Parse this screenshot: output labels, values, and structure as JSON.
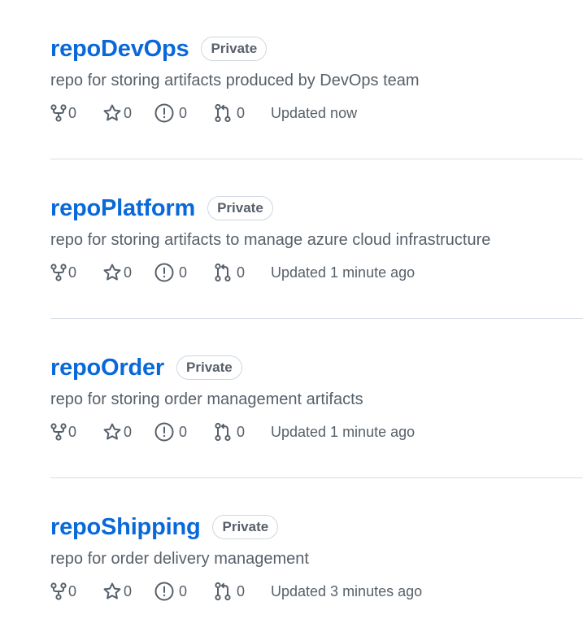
{
  "repos": [
    {
      "name": "repoDevOps",
      "visibility": "Private",
      "description": "repo for storing artifacts produced by DevOps team",
      "forks": "0",
      "stars": "0",
      "issues": "0",
      "pulls": "0",
      "updated": "Updated now"
    },
    {
      "name": "repoPlatform",
      "visibility": "Private",
      "description": "repo for storing artifacts to manage azure cloud infrastructure",
      "forks": "0",
      "stars": "0",
      "issues": "0",
      "pulls": "0",
      "updated": "Updated 1 minute ago"
    },
    {
      "name": "repoOrder",
      "visibility": "Private",
      "description": "repo for storing order management artifacts",
      "forks": "0",
      "stars": "0",
      "issues": "0",
      "pulls": "0",
      "updated": "Updated 1 minute ago"
    },
    {
      "name": "repoShipping",
      "visibility": "Private",
      "description": "repo for order delivery management",
      "forks": "0",
      "stars": "0",
      "issues": "0",
      "pulls": "0",
      "updated": "Updated 3 minutes ago"
    }
  ],
  "icons": {
    "fork": "repo-forked-icon",
    "star": "star-icon",
    "issue": "issue-opened-icon",
    "pull": "git-pull-request-icon"
  },
  "colors": {
    "link": "#0969da",
    "muted": "#57606a",
    "border": "#d8dee4"
  }
}
